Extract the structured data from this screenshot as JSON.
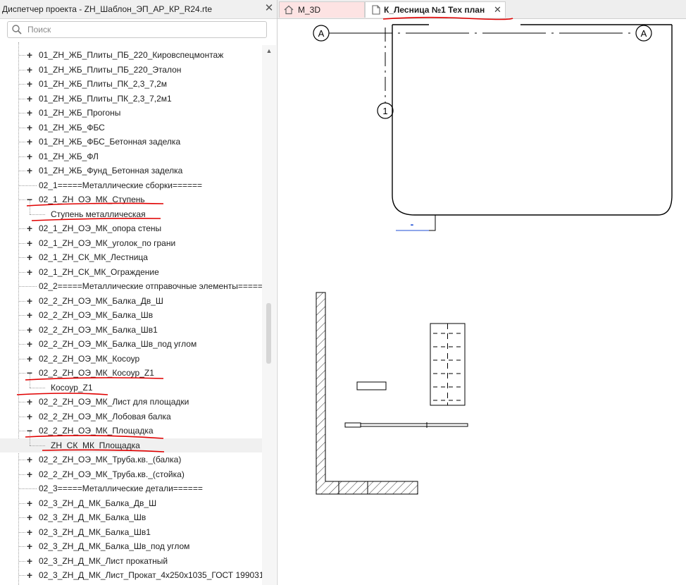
{
  "project_browser": {
    "title": "Диспетчер проекта - ZH_Шаблон_ЭП_АР_КР_R24.rte",
    "close_glyph": "✕",
    "search_placeholder": "Поиск",
    "items": [
      {
        "label": "01_ZH_ЖБ_Плиты_ПБ_220_Кировспецмонтаж",
        "level": 1,
        "toggle": "+"
      },
      {
        "label": "01_ZH_ЖБ_Плиты_ПБ_220_Эталон",
        "level": 1,
        "toggle": "+"
      },
      {
        "label": "01_ZH_ЖБ_Плиты_ПК_2,3_7,2м",
        "level": 1,
        "toggle": "+"
      },
      {
        "label": "01_ZH_ЖБ_Плиты_ПК_2,3_7,2м1",
        "level": 1,
        "toggle": "+"
      },
      {
        "label": "01_ZH_ЖБ_Прогоны",
        "level": 1,
        "toggle": "+"
      },
      {
        "label": "01_ZH_ЖБ_ФБС",
        "level": 1,
        "toggle": "+"
      },
      {
        "label": "01_ZH_ЖБ_ФБС_Бетонная заделка",
        "level": 1,
        "toggle": "+"
      },
      {
        "label": "01_ZH_ЖБ_ФЛ",
        "level": 1,
        "toggle": "+"
      },
      {
        "label": "01_ZH_ЖБ_Фунд_Бетонная заделка",
        "level": 1,
        "toggle": "+"
      },
      {
        "label": "02_1=====Металлические сборки======",
        "level": 1,
        "toggle": ""
      },
      {
        "label": "02_1_ZH_ОЭ_МК_Ступень",
        "level": 1,
        "toggle": "−"
      },
      {
        "label": "Ступень металлическая",
        "level": 2,
        "toggle": ""
      },
      {
        "label": "02_1_ZH_ОЭ_МК_опора стены",
        "level": 1,
        "toggle": "+"
      },
      {
        "label": "02_1_ZH_ОЭ_МК_уголок_по грани",
        "level": 1,
        "toggle": "+"
      },
      {
        "label": "02_1_ZH_СК_МК_Лестница",
        "level": 1,
        "toggle": "+"
      },
      {
        "label": "02_1_ZH_СК_МК_Ограждение",
        "level": 1,
        "toggle": "+"
      },
      {
        "label": "02_2=====Металлические отправочные элементы=====",
        "level": 1,
        "toggle": ""
      },
      {
        "label": "02_2_ZH_ОЭ_МК_Балка_Дв_Ш",
        "level": 1,
        "toggle": "+"
      },
      {
        "label": "02_2_ZH_ОЭ_МК_Балка_Шв",
        "level": 1,
        "toggle": "+"
      },
      {
        "label": "02_2_ZH_ОЭ_МК_Балка_Шв1",
        "level": 1,
        "toggle": "+"
      },
      {
        "label": "02_2_ZH_ОЭ_МК_Балка_Шв_под углом",
        "level": 1,
        "toggle": "+"
      },
      {
        "label": "02_2_ZH_ОЭ_МК_Косоур",
        "level": 1,
        "toggle": "+"
      },
      {
        "label": "02_2_ZH_ОЭ_МК_Косоур_Z1",
        "level": 1,
        "toggle": "−"
      },
      {
        "label": "Косоур_Z1",
        "level": 2,
        "toggle": ""
      },
      {
        "label": "02_2_ZH_ОЭ_МК_Лист для площадки",
        "level": 1,
        "toggle": "+"
      },
      {
        "label": "02_2_ZH_ОЭ_МК_Лобовая балка",
        "level": 1,
        "toggle": "+"
      },
      {
        "label": "02_2_ZH_ОЭ_МК_Площадка",
        "level": 1,
        "toggle": "−"
      },
      {
        "label": "ZH_СК_МК_Площадка",
        "level": 2,
        "toggle": "",
        "selected": true
      },
      {
        "label": "02_2_ZH_ОЭ_МК_Труба.кв._(балка)",
        "level": 1,
        "toggle": "+"
      },
      {
        "label": "02_2_ZH_ОЭ_МК_Труба.кв._(стойка)",
        "level": 1,
        "toggle": "+"
      },
      {
        "label": "02_3=====Металлические детали======",
        "level": 1,
        "toggle": ""
      },
      {
        "label": "02_3_ZH_Д_МК_Балка_Дв_Ш",
        "level": 1,
        "toggle": "+"
      },
      {
        "label": "02_3_ZH_Д_МК_Балка_Шв",
        "level": 1,
        "toggle": "+"
      },
      {
        "label": "02_3_ZH_Д_МК_Балка_Шв1",
        "level": 1,
        "toggle": "+"
      },
      {
        "label": "02_3_ZH_Д_МК_Балка_Шв_под углом",
        "level": 1,
        "toggle": "+"
      },
      {
        "label": "02_3_ZH_Д_МК_Лист прокатный",
        "level": 1,
        "toggle": "+"
      },
      {
        "label": "02_3_ZH_Д_МК_Лист_Прокат_4x250x1035_ГОСТ 199031",
        "level": 1,
        "toggle": "+"
      }
    ]
  },
  "tabs": [
    {
      "label": "M_3D",
      "icon": "home-icon",
      "active": false
    },
    {
      "label": "К_Лесница №1 Тех план",
      "icon": "sheet-icon",
      "active": true,
      "close_glyph": "✕"
    }
  ],
  "drawing": {
    "grid_bubble_a": "A",
    "grid_bubble_1": "1",
    "level_mark": "-"
  },
  "colors": {
    "annotation_red": "#e00000",
    "tab_inactive_bg": "#fde3e3",
    "selection_bg": "#f0f0f0",
    "level_mark_blue": "#1f4fd6"
  }
}
